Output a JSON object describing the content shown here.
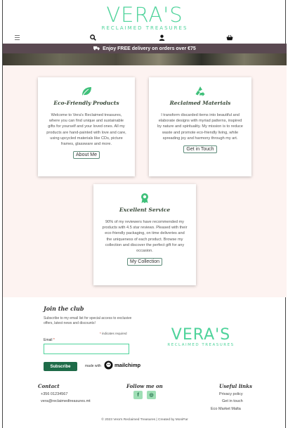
{
  "header": {
    "logo_main": "VERA'S",
    "logo_sub": "RECLAIMED TREASURES",
    "icons": [
      "hamburger-menu-icon",
      "search-icon",
      "user-icon",
      "basket-icon"
    ]
  },
  "banner": {
    "text": "Enjoy FREE delivery on orders over €75",
    "icon": "truck-icon",
    "color": "#5a4951"
  },
  "cards": [
    {
      "icon": "leaf-icon",
      "title": "Eco-Friendly Products",
      "text": "Welcome to Vera's Reclaimed treasures, where you can find unique and sustainable gifts for yourself and your loved ones. All my products are hand-painted with love and care, using upcycled materials like CDs, picture frames, glassware and more.",
      "button": "About Me"
    },
    {
      "icon": "recycle-icon",
      "title": "Reclaimed Materials",
      "text": "I transform discarded items into beautiful and elaborate designs with myriad patterns, inspired by nature and spirituality. My mission is to reduce waste and promote eco-friendly living, while spreading joy and harmony through my art.",
      "button": "Get in Touch"
    },
    {
      "icon": "award-icon",
      "title": "Excellent Service",
      "text": "90% of my reviewers have recommended my products with 4.5 star reviews. Pleased with their eco-friendly packaging, on time deliveries and the uniqueness of each product. Browse my collection and discover the perfect gift for any occasion.",
      "button": "My Collection"
    }
  ],
  "newsletter": {
    "title": "Join the club",
    "description": "Subscribe to my email list for special access to exclusive offers, latest news and discounts!",
    "required_note": "indicates required",
    "email_label": "Email",
    "email_value": "",
    "subscribe_label": "Subscribe",
    "made_with": "made with",
    "brand": "mailchimp"
  },
  "footer": {
    "contact_title": "Contact",
    "phone": "+356 01234567",
    "email": "vera@reclaimedtreasures.mt",
    "follow_title": "Follow me on",
    "social": [
      "f",
      "◎"
    ],
    "links_title": "Useful links",
    "links": [
      "Privacy policy",
      "Get in touch",
      "Eco Market Malta"
    ],
    "copyright": "© 2023 Vera's Reclaimed Treasures | Created by MoniPar"
  },
  "colors": {
    "brand_green": "#4fd39b",
    "dark_green": "#1e6b48",
    "banner": "#5a4951",
    "pink_bg": "#fdf3f1"
  }
}
